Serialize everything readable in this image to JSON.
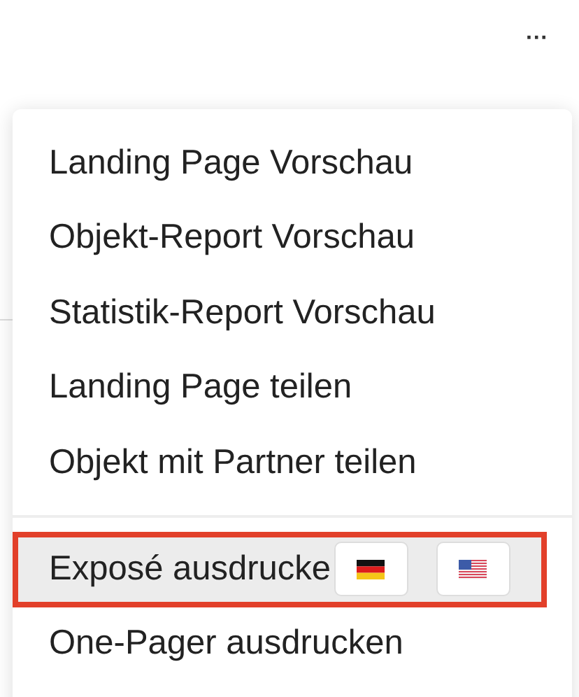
{
  "more_button": {
    "label": "···"
  },
  "menu": {
    "groups": [
      {
        "items": [
          {
            "label": "Landing Page Vorschau",
            "highlighted": false
          },
          {
            "label": "Objekt-Report Vorschau",
            "highlighted": false
          },
          {
            "label": "Statistik-Report Vorschau",
            "highlighted": false
          },
          {
            "label": "Landing Page teilen",
            "highlighted": false
          },
          {
            "label": "Objekt mit Partner teilen",
            "highlighted": false
          }
        ]
      },
      {
        "items": [
          {
            "label": "Exposé ausdrucke",
            "highlighted": true,
            "kind": "flags",
            "flags": [
              {
                "kind": "de"
              },
              {
                "kind": "us"
              }
            ]
          },
          {
            "label": "One-Pager ausdrucken",
            "highlighted": false
          }
        ]
      }
    ]
  }
}
